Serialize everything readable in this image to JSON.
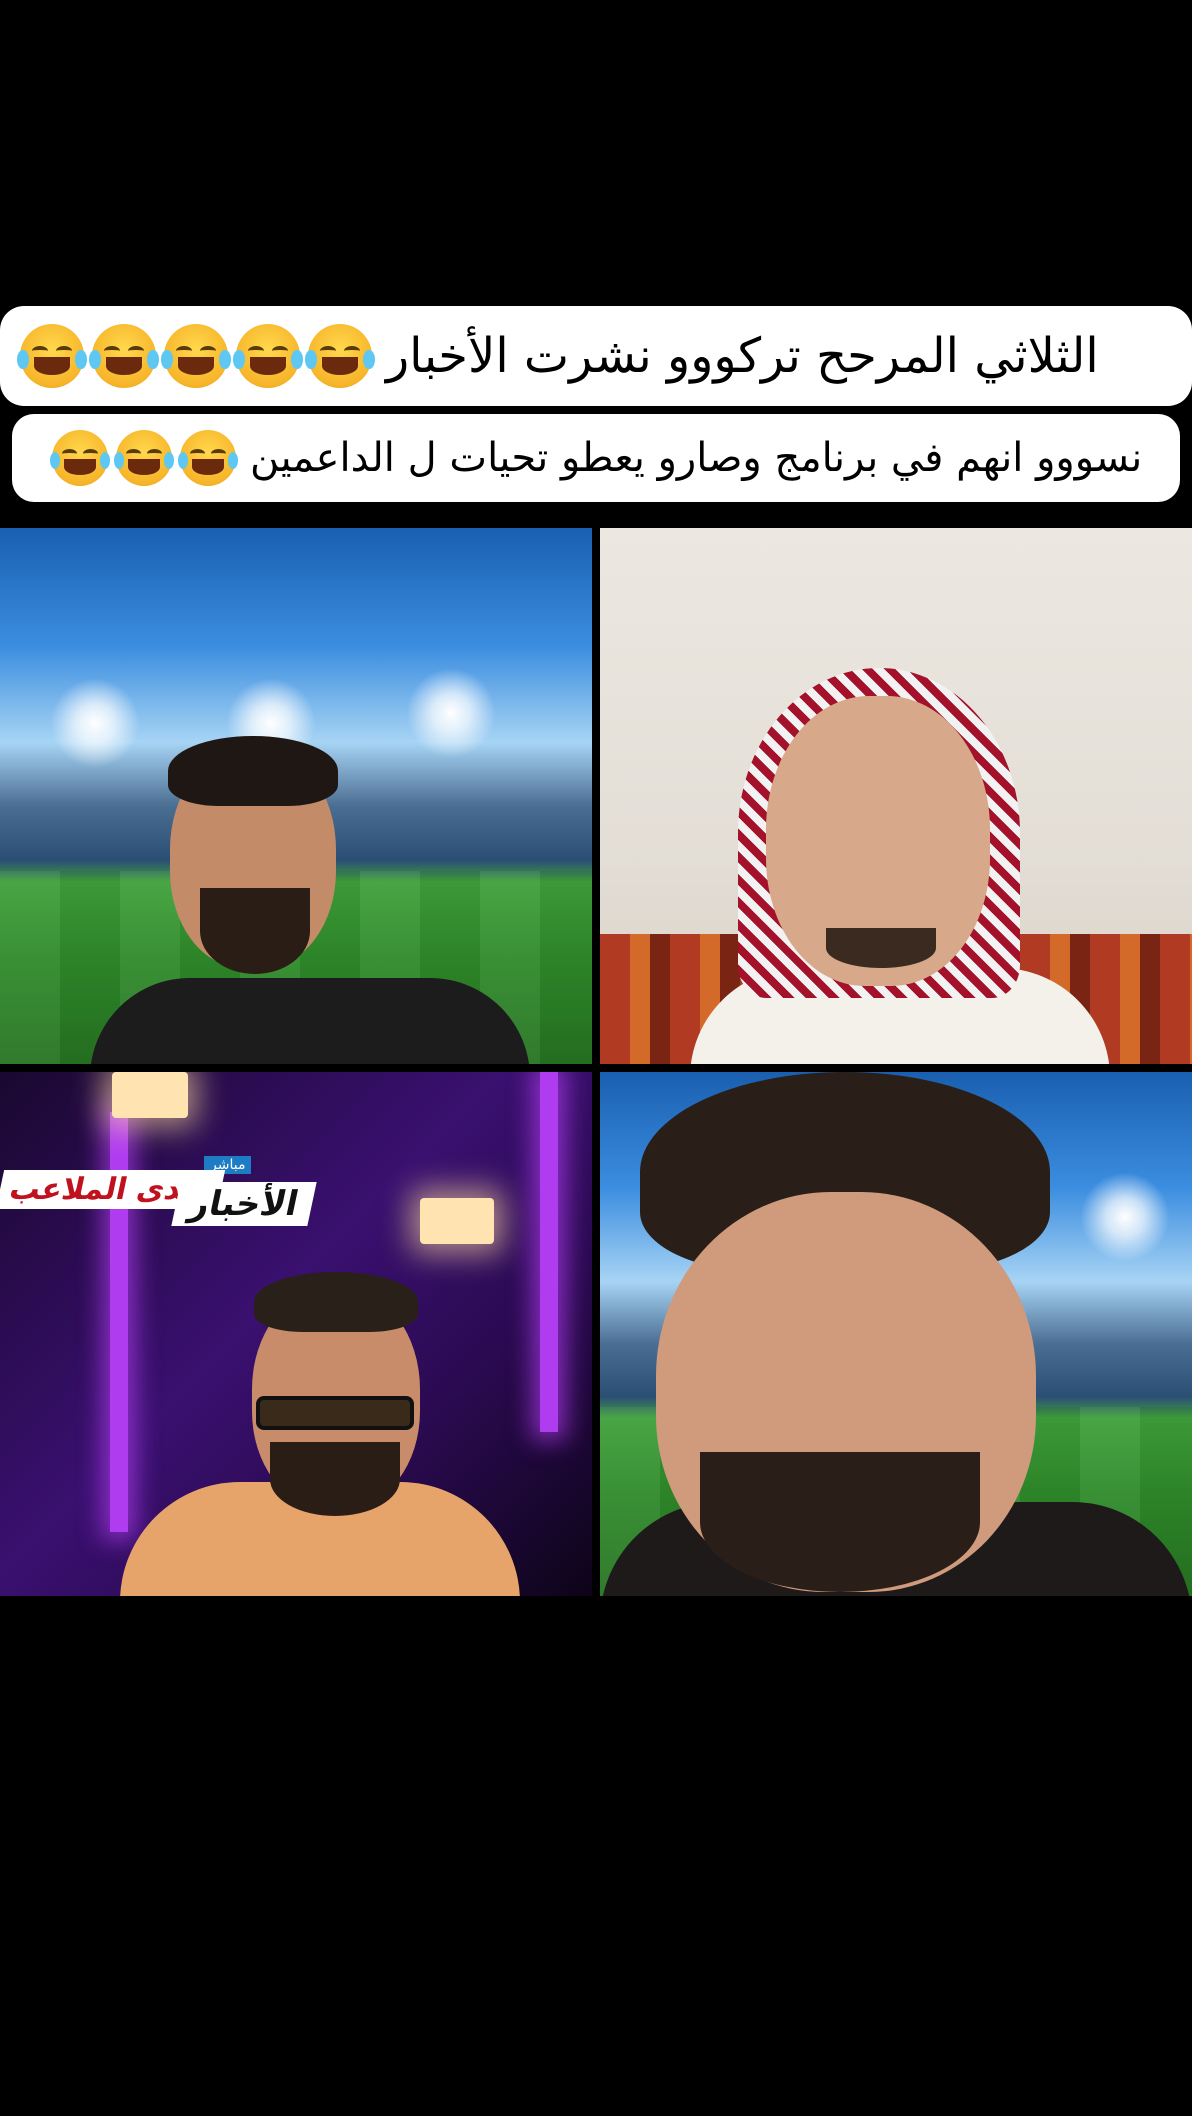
{
  "captions": {
    "line1": "الثلاثي المرحح تركووو نشرت الأخبار",
    "line2": "نسووو انهم في برنامج وصارو يعطو تحيات ل الداعمين"
  },
  "emoji": "laughing-crying-face",
  "video_grid": {
    "tiles": [
      {
        "id": "top-left",
        "background": "stadium"
      },
      {
        "id": "top-right",
        "background": "room"
      },
      {
        "id": "bottom-left",
        "background": "studio",
        "overlay": {
          "tag": "مباشر",
          "title": "صدى الملاعب",
          "subtitle": "الأخبار"
        }
      },
      {
        "id": "bottom-right",
        "background": "stadium"
      }
    ]
  },
  "colors": {
    "page_bg": "#000000",
    "caption_bg": "#ffffff"
  }
}
